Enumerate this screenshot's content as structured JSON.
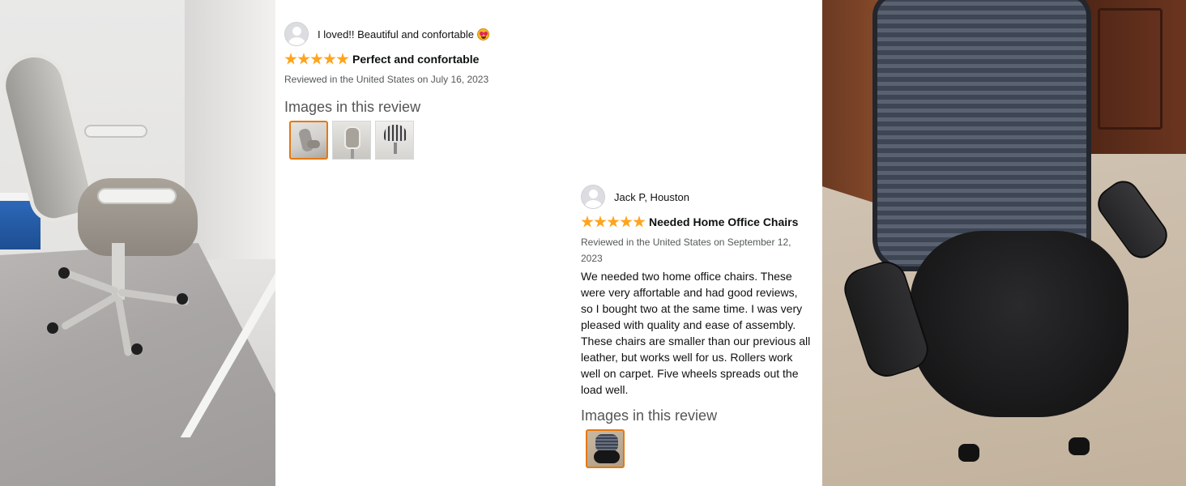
{
  "left_photo": {
    "subject": "white and grey mesh office chair in room corner"
  },
  "right_photo": {
    "subject": "black mesh office chair on carpet"
  },
  "reviews": [
    {
      "reviewer": "I loved!! Beautiful and confortable",
      "reviewer_emoji": "heart-eyes-emoji",
      "rating": 5,
      "title": "Perfect and confortable",
      "date_line": "Reviewed in the United States on July 16, 2023",
      "body": "",
      "images_heading": "Images in this review",
      "image_count": 3,
      "selected_image": 0
    },
    {
      "reviewer": "Jack P, Houston",
      "rating": 5,
      "title": "Needed Home Office Chairs",
      "date_line": "Reviewed in the United States on September 12, 2023",
      "body": "We needed two home office chairs. These were very affortable and had good reviews, so I bought two at the same time. I was very pleased with quality and ease of assembly. These chairs are smaller than our previous all leather, but works well for us. Rollers work well on carpet. Five wheels spreads out the load well.",
      "images_heading": "Images in this review",
      "image_count": 1,
      "selected_image": 0
    }
  ],
  "colors": {
    "star": "#ffa41c",
    "thumb_selected_border": "#e47911",
    "text_muted": "#565959"
  }
}
